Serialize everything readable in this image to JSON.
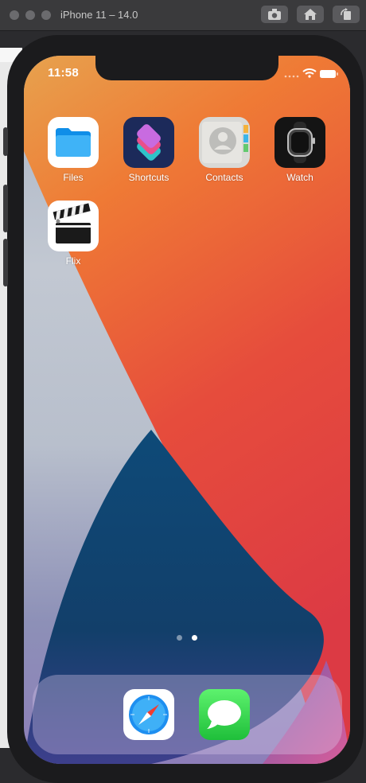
{
  "window": {
    "title": "iPhone 11 – 14.0"
  },
  "status_bar": {
    "time": "11:58",
    "icons": [
      "signal-icon",
      "wifi-icon",
      "battery-icon"
    ]
  },
  "home_screen": {
    "apps": [
      {
        "label": "Files",
        "icon": "files-icon"
      },
      {
        "label": "Shortcuts",
        "icon": "shortcuts-icon"
      },
      {
        "label": "Contacts",
        "icon": "contacts-icon"
      },
      {
        "label": "Watch",
        "icon": "watch-icon"
      },
      {
        "label": "Flix",
        "icon": "clapperboard-icon"
      }
    ],
    "page_indicator": {
      "pages": 2,
      "current": 2
    }
  },
  "dock": {
    "apps": [
      {
        "icon": "safari-icon"
      },
      {
        "icon": "messages-icon"
      }
    ]
  },
  "colors": {
    "accent_orange": "#ef6a2e",
    "wallpaper_red": "#e03c3c",
    "wallpaper_blue": "#0f4c7a"
  }
}
